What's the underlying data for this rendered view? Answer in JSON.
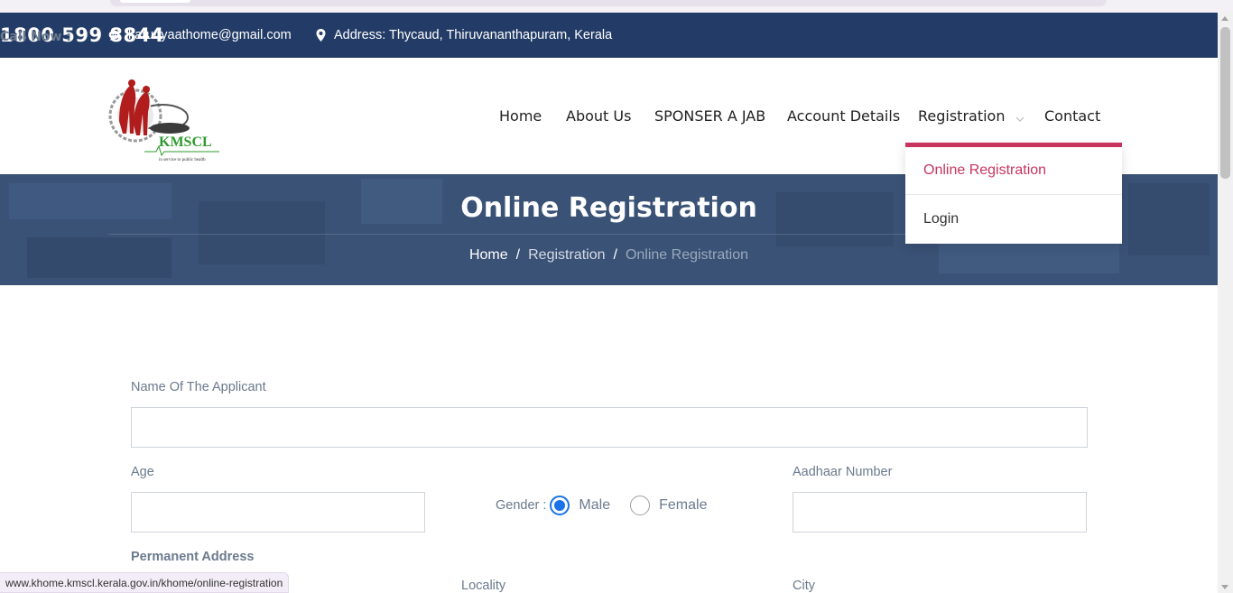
{
  "topbar": {
    "email": "karunyaathome@gmail.com",
    "address": "Address: Thycaud, Thiruvananthapuram, Kerala",
    "call_label": "Call Now :",
    "call_number": "1800 599 8844"
  },
  "logo": {
    "text": "KMSCL",
    "tagline": "in service to public health"
  },
  "nav": {
    "items": [
      {
        "label": "Home"
      },
      {
        "label": "About Us"
      },
      {
        "label": "SPONSER A JAB"
      },
      {
        "label": "Account Details"
      },
      {
        "label": "Registration"
      },
      {
        "label": "Contact"
      }
    ],
    "dropdown": [
      {
        "label": "Online Registration"
      },
      {
        "label": "Login"
      }
    ]
  },
  "banner": {
    "title": "Online Registration",
    "breadcrumbs": [
      "Home",
      "Registration",
      "Online Registration"
    ]
  },
  "form": {
    "name_label": "Name Of The Applicant",
    "age_label": "Age",
    "aadhaar_label": "Aadhaar Number",
    "gender_label": "Gender :",
    "gender_options": [
      {
        "label": "Male",
        "checked": true
      },
      {
        "label": "Female",
        "checked": false
      }
    ],
    "permanent_address": "Permanent Address",
    "locality_label": "Locality",
    "city_label": "City"
  },
  "status_url": "www.khome.kmscl.kerala.gov.in/khome/online-registration",
  "colors": {
    "topbar_bg": "#233c67",
    "accent": "#c8345f",
    "banner_bg": "#3a5276",
    "label_text": "#6b7a8d"
  }
}
